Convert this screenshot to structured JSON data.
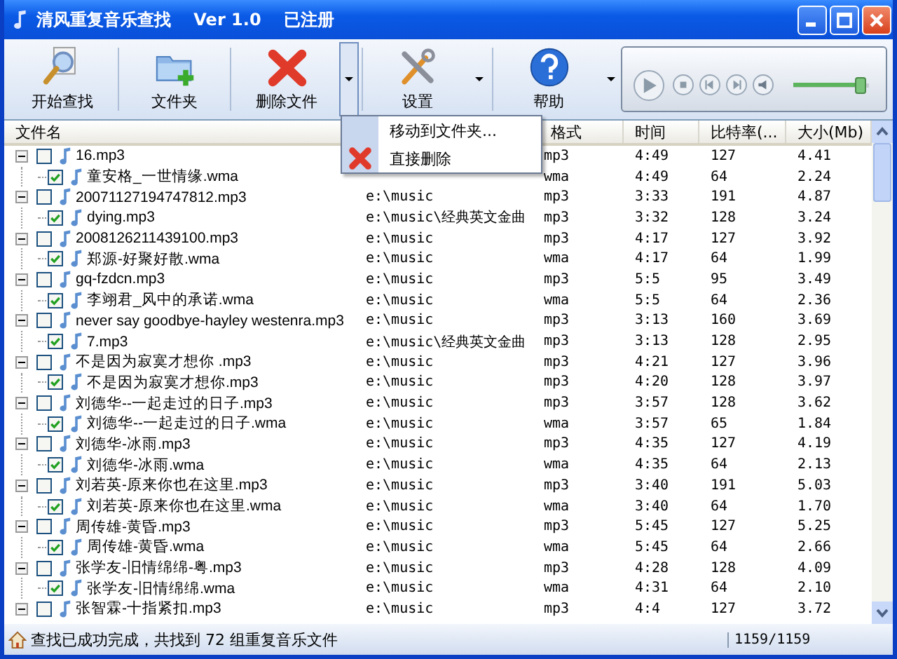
{
  "window": {
    "title": "清风重复音乐查找　 Ver 1.0　 已注册"
  },
  "toolbar": [
    {
      "label": "开始查找",
      "kind": "search",
      "dropdown": false,
      "pressed": false
    },
    {
      "label": "文件夹",
      "kind": "folder",
      "dropdown": false,
      "pressed": false
    },
    {
      "label": "删除文件",
      "kind": "delete",
      "dropdown": true,
      "pressed": true
    },
    {
      "label": "设置",
      "kind": "settings",
      "dropdown": true,
      "pressed": false
    },
    {
      "label": "帮助",
      "kind": "help",
      "dropdown": true,
      "pressed": false
    }
  ],
  "player": {
    "volume": {
      "level": 0.88
    }
  },
  "columns": [
    "文件名",
    "格式",
    "时间",
    "比特率(...",
    "大小(Mb)"
  ],
  "files": [
    {
      "name": "16.mp3",
      "format": "mp3",
      "time": "4:49",
      "bitrate": "127",
      "size": "4.41",
      "checked": false,
      "expanded": true,
      "children": [
        {
          "name": "童安格_一世情缘.wma",
          "format": "wma",
          "time": "4:49",
          "bitrate": "64",
          "size": "2.24",
          "checked": true
        }
      ]
    },
    {
      "name": "20071127194747812.mp3",
      "path": "e:\\music",
      "format": "mp3",
      "time": "3:33",
      "bitrate": "191",
      "size": "4.87",
      "checked": false,
      "expanded": true,
      "children": [
        {
          "name": "dying.mp3",
          "path": "e:\\music\\经典英文金曲",
          "format": "mp3",
          "time": "3:32",
          "bitrate": "128",
          "size": "3.24",
          "checked": true
        }
      ]
    },
    {
      "name": "2008126211439100.mp3",
      "path": "e:\\music",
      "format": "mp3",
      "time": "4:17",
      "bitrate": "127",
      "size": "3.92",
      "checked": false,
      "expanded": true,
      "children": [
        {
          "name": "郑源-好聚好散.wma",
          "path": "e:\\music",
          "format": "wma",
          "time": "4:17",
          "bitrate": "64",
          "size": "1.99",
          "checked": true
        }
      ]
    },
    {
      "name": "gq-fzdcn.mp3",
      "path": "e:\\music",
      "format": "mp3",
      "time": "5:5",
      "bitrate": "95",
      "size": "3.49",
      "checked": false,
      "expanded": true,
      "children": [
        {
          "name": "李翊君_风中的承诺.wma",
          "path": "e:\\music",
          "format": "wma",
          "time": "5:5",
          "bitrate": "64",
          "size": "2.36",
          "checked": true
        }
      ]
    },
    {
      "name": "never say goodbye-hayley westenra.mp3",
      "path": "e:\\music",
      "format": "mp3",
      "time": "3:13",
      "bitrate": "160",
      "size": "3.69",
      "checked": false,
      "expanded": true,
      "children": [
        {
          "name": "7.mp3",
          "path": "e:\\music\\经典英文金曲",
          "format": "mp3",
          "time": "3:13",
          "bitrate": "128",
          "size": "2.95",
          "checked": true
        }
      ]
    },
    {
      "name": "不是因为寂寞才想你 .mp3",
      "path": "e:\\music",
      "format": "mp3",
      "time": "4:21",
      "bitrate": "127",
      "size": "3.96",
      "checked": false,
      "expanded": true,
      "children": [
        {
          "name": "不是因为寂寞才想你.mp3",
          "path": "e:\\music",
          "format": "mp3",
          "time": "4:20",
          "bitrate": "128",
          "size": "3.97",
          "checked": true
        }
      ]
    },
    {
      "name": "刘德华--一起走过的日子.mp3",
      "path": "e:\\music",
      "format": "mp3",
      "time": "3:57",
      "bitrate": "128",
      "size": "3.62",
      "checked": false,
      "expanded": true,
      "children": [
        {
          "name": "刘德华--一起走过的日子.wma",
          "path": "e:\\music",
          "format": "wma",
          "time": "3:57",
          "bitrate": "65",
          "size": "1.84",
          "checked": true
        }
      ]
    },
    {
      "name": "刘德华-冰雨.mp3",
      "path": "e:\\music",
      "format": "mp3",
      "time": "4:35",
      "bitrate": "127",
      "size": "4.19",
      "checked": false,
      "expanded": true,
      "children": [
        {
          "name": "刘德华-冰雨.wma",
          "path": "e:\\music",
          "format": "wma",
          "time": "4:35",
          "bitrate": "64",
          "size": "2.13",
          "checked": true
        }
      ]
    },
    {
      "name": "刘若英-原来你也在这里.mp3",
      "path": "e:\\music",
      "format": "mp3",
      "time": "3:40",
      "bitrate": "191",
      "size": "5.03",
      "checked": false,
      "expanded": true,
      "children": [
        {
          "name": "刘若英-原来你也在这里.wma",
          "path": "e:\\music",
          "format": "wma",
          "time": "3:40",
          "bitrate": "64",
          "size": "1.70",
          "checked": true
        }
      ]
    },
    {
      "name": "周传雄-黄昏.mp3",
      "path": "e:\\music",
      "format": "mp3",
      "time": "5:45",
      "bitrate": "127",
      "size": "5.25",
      "checked": false,
      "expanded": true,
      "children": [
        {
          "name": "周传雄-黄昏.wma",
          "path": "e:\\music",
          "format": "wma",
          "time": "5:45",
          "bitrate": "64",
          "size": "2.66",
          "checked": true
        }
      ]
    },
    {
      "name": "张学友-旧情绵绵-粤.mp3",
      "path": "e:\\music",
      "format": "mp3",
      "time": "4:28",
      "bitrate": "128",
      "size": "4.09",
      "checked": false,
      "expanded": true,
      "children": [
        {
          "name": "张学友-旧情绵绵.wma",
          "path": "e:\\music",
          "format": "wma",
          "time": "4:31",
          "bitrate": "64",
          "size": "2.10",
          "checked": true
        }
      ]
    },
    {
      "name": "张智霖-十指紧扣.mp3",
      "path": "e:\\music",
      "format": "mp3",
      "time": "4:4",
      "bitrate": "127",
      "size": "3.72",
      "checked": false,
      "expanded": true
    }
  ],
  "context_menu": [
    {
      "label": "移动到文件夹...",
      "kind": "move"
    },
    {
      "label": "直接删除",
      "kind": "delete"
    }
  ],
  "status_bar": {
    "message": "查找已成功完成，共找到 72 组重复音乐文件",
    "count": "1159/1159"
  }
}
